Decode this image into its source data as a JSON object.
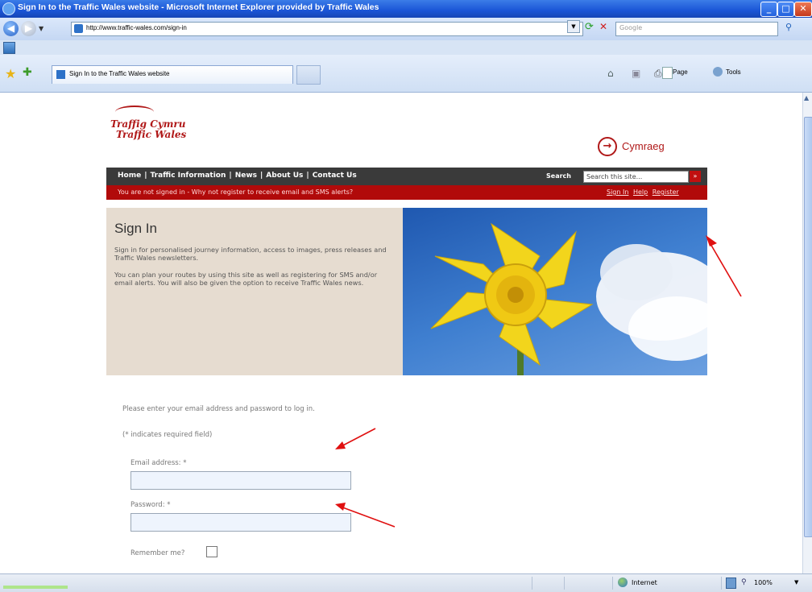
{
  "window": {
    "title": "Sign In to the Traffic Wales website - Microsoft Internet Explorer provided by Traffic Wales",
    "min": "_",
    "max": "□",
    "close": "✕"
  },
  "addressbar": {
    "url": "http://www.traffic-wales.com/sign-in",
    "search_placeholder": "Google"
  },
  "tabs": {
    "active_label": "Sign In to the Traffic Wales website"
  },
  "commandbar": {
    "page": "Page",
    "tools": "Tools"
  },
  "site": {
    "logo_line1": "Traffig Cymru",
    "logo_line2": "Traffic Wales",
    "language_link": "Cymraeg",
    "nav": [
      "Home",
      "Traffic Information",
      "News",
      "About Us",
      "Contact Us"
    ],
    "search_label": "Search",
    "search_placeholder": "Search this site...",
    "alert": "You are not signed in - Why not register to receive email and SMS alerts?",
    "alert_links": [
      "Sign In",
      "Help",
      "Register"
    ],
    "intro_heading": "Sign In",
    "intro_p1": "Sign in for personalised journey information, access to images, press releases and Traffic Wales newsletters.",
    "intro_p2": "You can plan your routes by using this site as well as registering for SMS and/or email alerts.  You will also be given the option to receive Traffic Wales news."
  },
  "form": {
    "intro": "Please enter your email address and password to log in.",
    "required_note": "(* indicates required field)",
    "email_label": "Email address: *",
    "password_label": "Password: *",
    "remember_label": "Remember me?"
  },
  "statusbar": {
    "zone": "Internet",
    "zoom": "100%"
  },
  "colors": {
    "brand_red": "#b01818",
    "nav_dark": "#3a3a3a",
    "alert_red": "#b10a0a",
    "intro_panel": "#e6dcd0"
  }
}
